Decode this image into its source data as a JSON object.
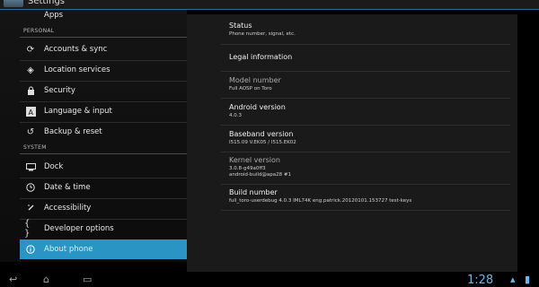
{
  "actionbar": {
    "title": "Settings"
  },
  "sidebar": {
    "apps": "Apps",
    "personal_header": "PERSONAL",
    "system_header": "SYSTEM",
    "items": [
      {
        "label": "Accounts & sync",
        "icon": "sync-icon"
      },
      {
        "label": "Location services",
        "icon": "location-icon"
      },
      {
        "label": "Security",
        "icon": "lock-icon"
      },
      {
        "label": "Language & input",
        "icon": "language-icon"
      },
      {
        "label": "Backup & reset",
        "icon": "reset-icon"
      },
      {
        "label": "Dock",
        "icon": "dock-icon"
      },
      {
        "label": "Date & time",
        "icon": "clock-icon"
      },
      {
        "label": "Accessibility",
        "icon": "accessibility-icon"
      },
      {
        "label": "Developer options",
        "icon": "developer-icon"
      },
      {
        "label": "About phone",
        "icon": "info-icon"
      }
    ],
    "active_color": "#2a95c5"
  },
  "about": {
    "status": {
      "title": "Status",
      "summary": "Phone number, signal, etc."
    },
    "legal": {
      "title": "Legal information"
    },
    "model": {
      "title": "Model number",
      "value": "Full AOSP on Toro"
    },
    "android": {
      "title": "Android version",
      "value": "4.0.3"
    },
    "baseband": {
      "title": "Baseband version",
      "value": "I515.09 V.EK05 / I515.EK02"
    },
    "kernel": {
      "title": "Kernel version",
      "value1": "3.0.8-g49a0ff3",
      "value2": "android-build@apa28 #1"
    },
    "build": {
      "title": "Build number",
      "value": "full_toro-userdebug 4.0.3 IML74K eng.patrick.20120101.153727 test-keys"
    }
  },
  "navbar": {
    "clock": "1:28"
  }
}
